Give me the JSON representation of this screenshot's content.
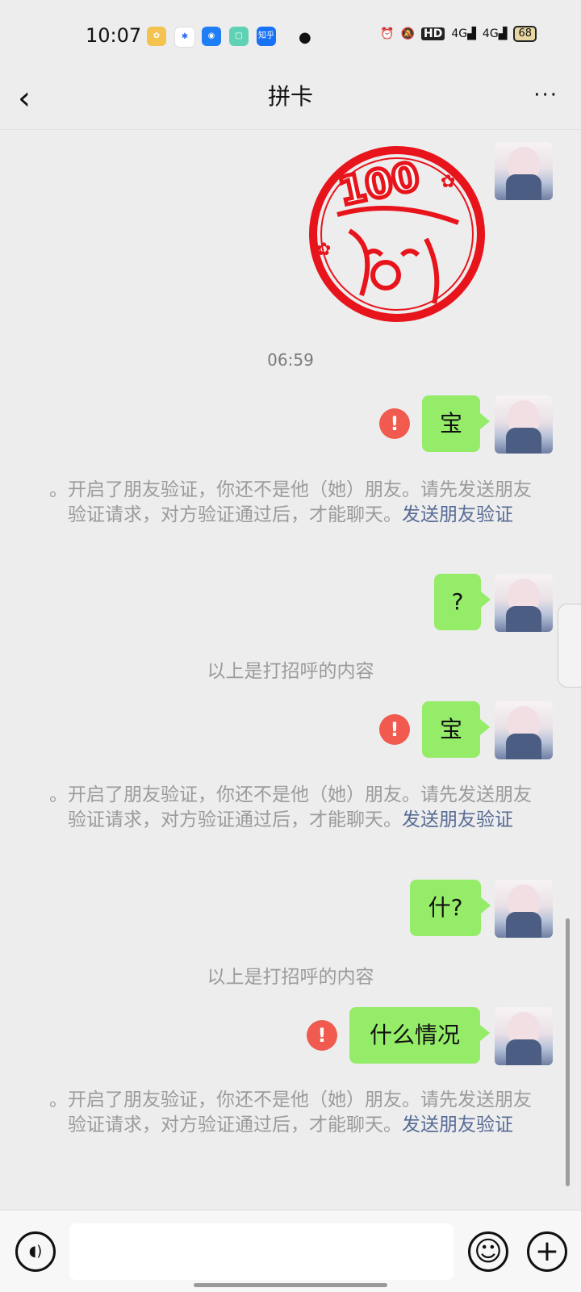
{
  "status_bar": {
    "time": "10:07",
    "apps": [
      "photo-app-icon",
      "baidu-icon",
      "qq-icon",
      "green-app-icon",
      "zhihu-icon"
    ],
    "zhihu_label": "知乎",
    "hd_label": "HD",
    "network1": "4G",
    "network2": "4G",
    "battery": "68"
  },
  "nav": {
    "back_glyph": "‹",
    "title": "拼卡",
    "more_glyph": "···"
  },
  "messages": {
    "timestamp": "06:59",
    "msg1": "宝",
    "msg2": "?",
    "msg3": "宝",
    "msg4": "什?",
    "msg5": "什么情况",
    "error_glyph": "!"
  },
  "system": {
    "verify_text": "。开启了朋友验证，你还不是他（她）朋友。请先发送朋友验证请求，对方验证通过后，才能聊天。",
    "verify_link": "发送朋友验证",
    "greeting_note": "以上是打招呼的内容"
  },
  "stamp": {
    "text": "100"
  },
  "input_bar": {
    "voice_glyph": "◖)",
    "emoji_glyph": "☺",
    "plus_glyph": "+"
  },
  "colors": {
    "bubble": "#95ec69",
    "error": "#f05a4f",
    "link": "#576b95",
    "stamp": "#e8141c"
  }
}
